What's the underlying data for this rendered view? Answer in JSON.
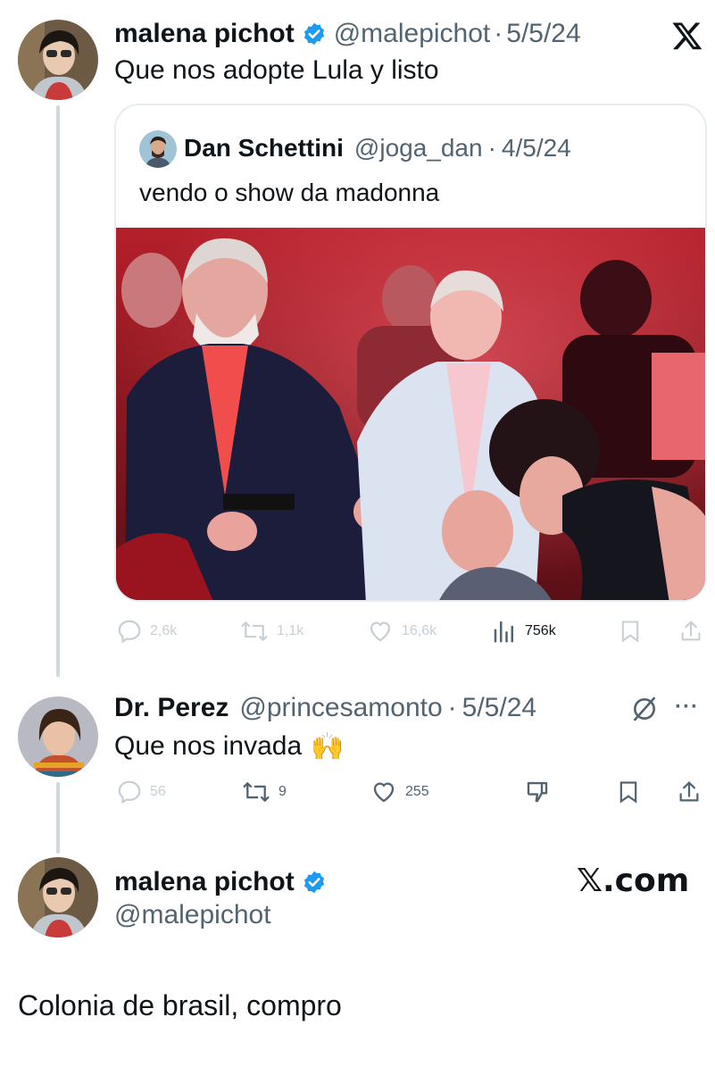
{
  "colors": {
    "verified": "#1d9bf0",
    "thread_line": "#cfd9de",
    "secondary_text": "#536471",
    "faded_text": "#c8d0d6"
  },
  "tweet1": {
    "name": "malena pichot",
    "handle": "@malepichot",
    "sep": "·",
    "date": "5/5/24",
    "text": "Que nos adopte Lula y listo",
    "verified_icon": "verified-badge-icon",
    "corner_logo": "X"
  },
  "quote": {
    "name": "Dan Schettini",
    "handle": "@joga_dan",
    "sep": "·",
    "date": "4/5/24",
    "text": "vendo o show da madonna"
  },
  "tweet1_actions": {
    "replies": "2,6k",
    "retweets": "1,1k",
    "likes": "16,6k",
    "views": "756k"
  },
  "tweet2": {
    "name": "Dr. Perez",
    "handle": "@princesamonto",
    "sep": "·",
    "date": "5/5/24",
    "text": "Que nos invada",
    "emoji": "🙌",
    "more": "···"
  },
  "tweet2_actions": {
    "replies": "56",
    "retweets": "9",
    "likes": "255"
  },
  "tweet3": {
    "name": "malena pichot",
    "handle": "@malepichot",
    "brand": "𝕏.com",
    "text": "Colonia de brasil, compro"
  }
}
